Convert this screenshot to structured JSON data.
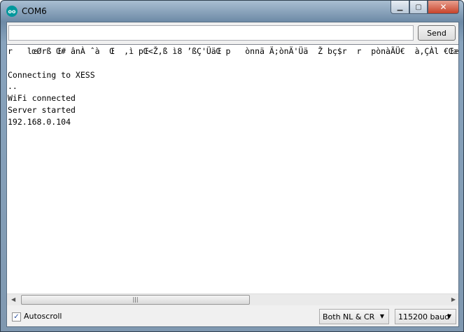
{
  "window": {
    "title": "COM6",
    "logo_text": "∞"
  },
  "input": {
    "value": "",
    "placeholder": ""
  },
  "send_label": "Send",
  "output_lines": [
    "r   lœØrß Œ# ânÀ ˆà  Œ  ,ì pŒ<Ž,ß ì8 ʼßÇ'ÜäŒ p   ònnä Ä;ònÄ'Üä  Ž bç$r  r  pònàÃÜ€  à,ÇÀl €ŒæÀ  € b",
    "",
    "Connecting to XESS",
    "..",
    "WiFi connected",
    "Server started",
    "192.168.0.104"
  ],
  "autoscroll": {
    "label": "Autoscroll",
    "checked": true
  },
  "line_ending": {
    "selected": "Both NL & CR"
  },
  "baud": {
    "selected": "115200 baud"
  }
}
